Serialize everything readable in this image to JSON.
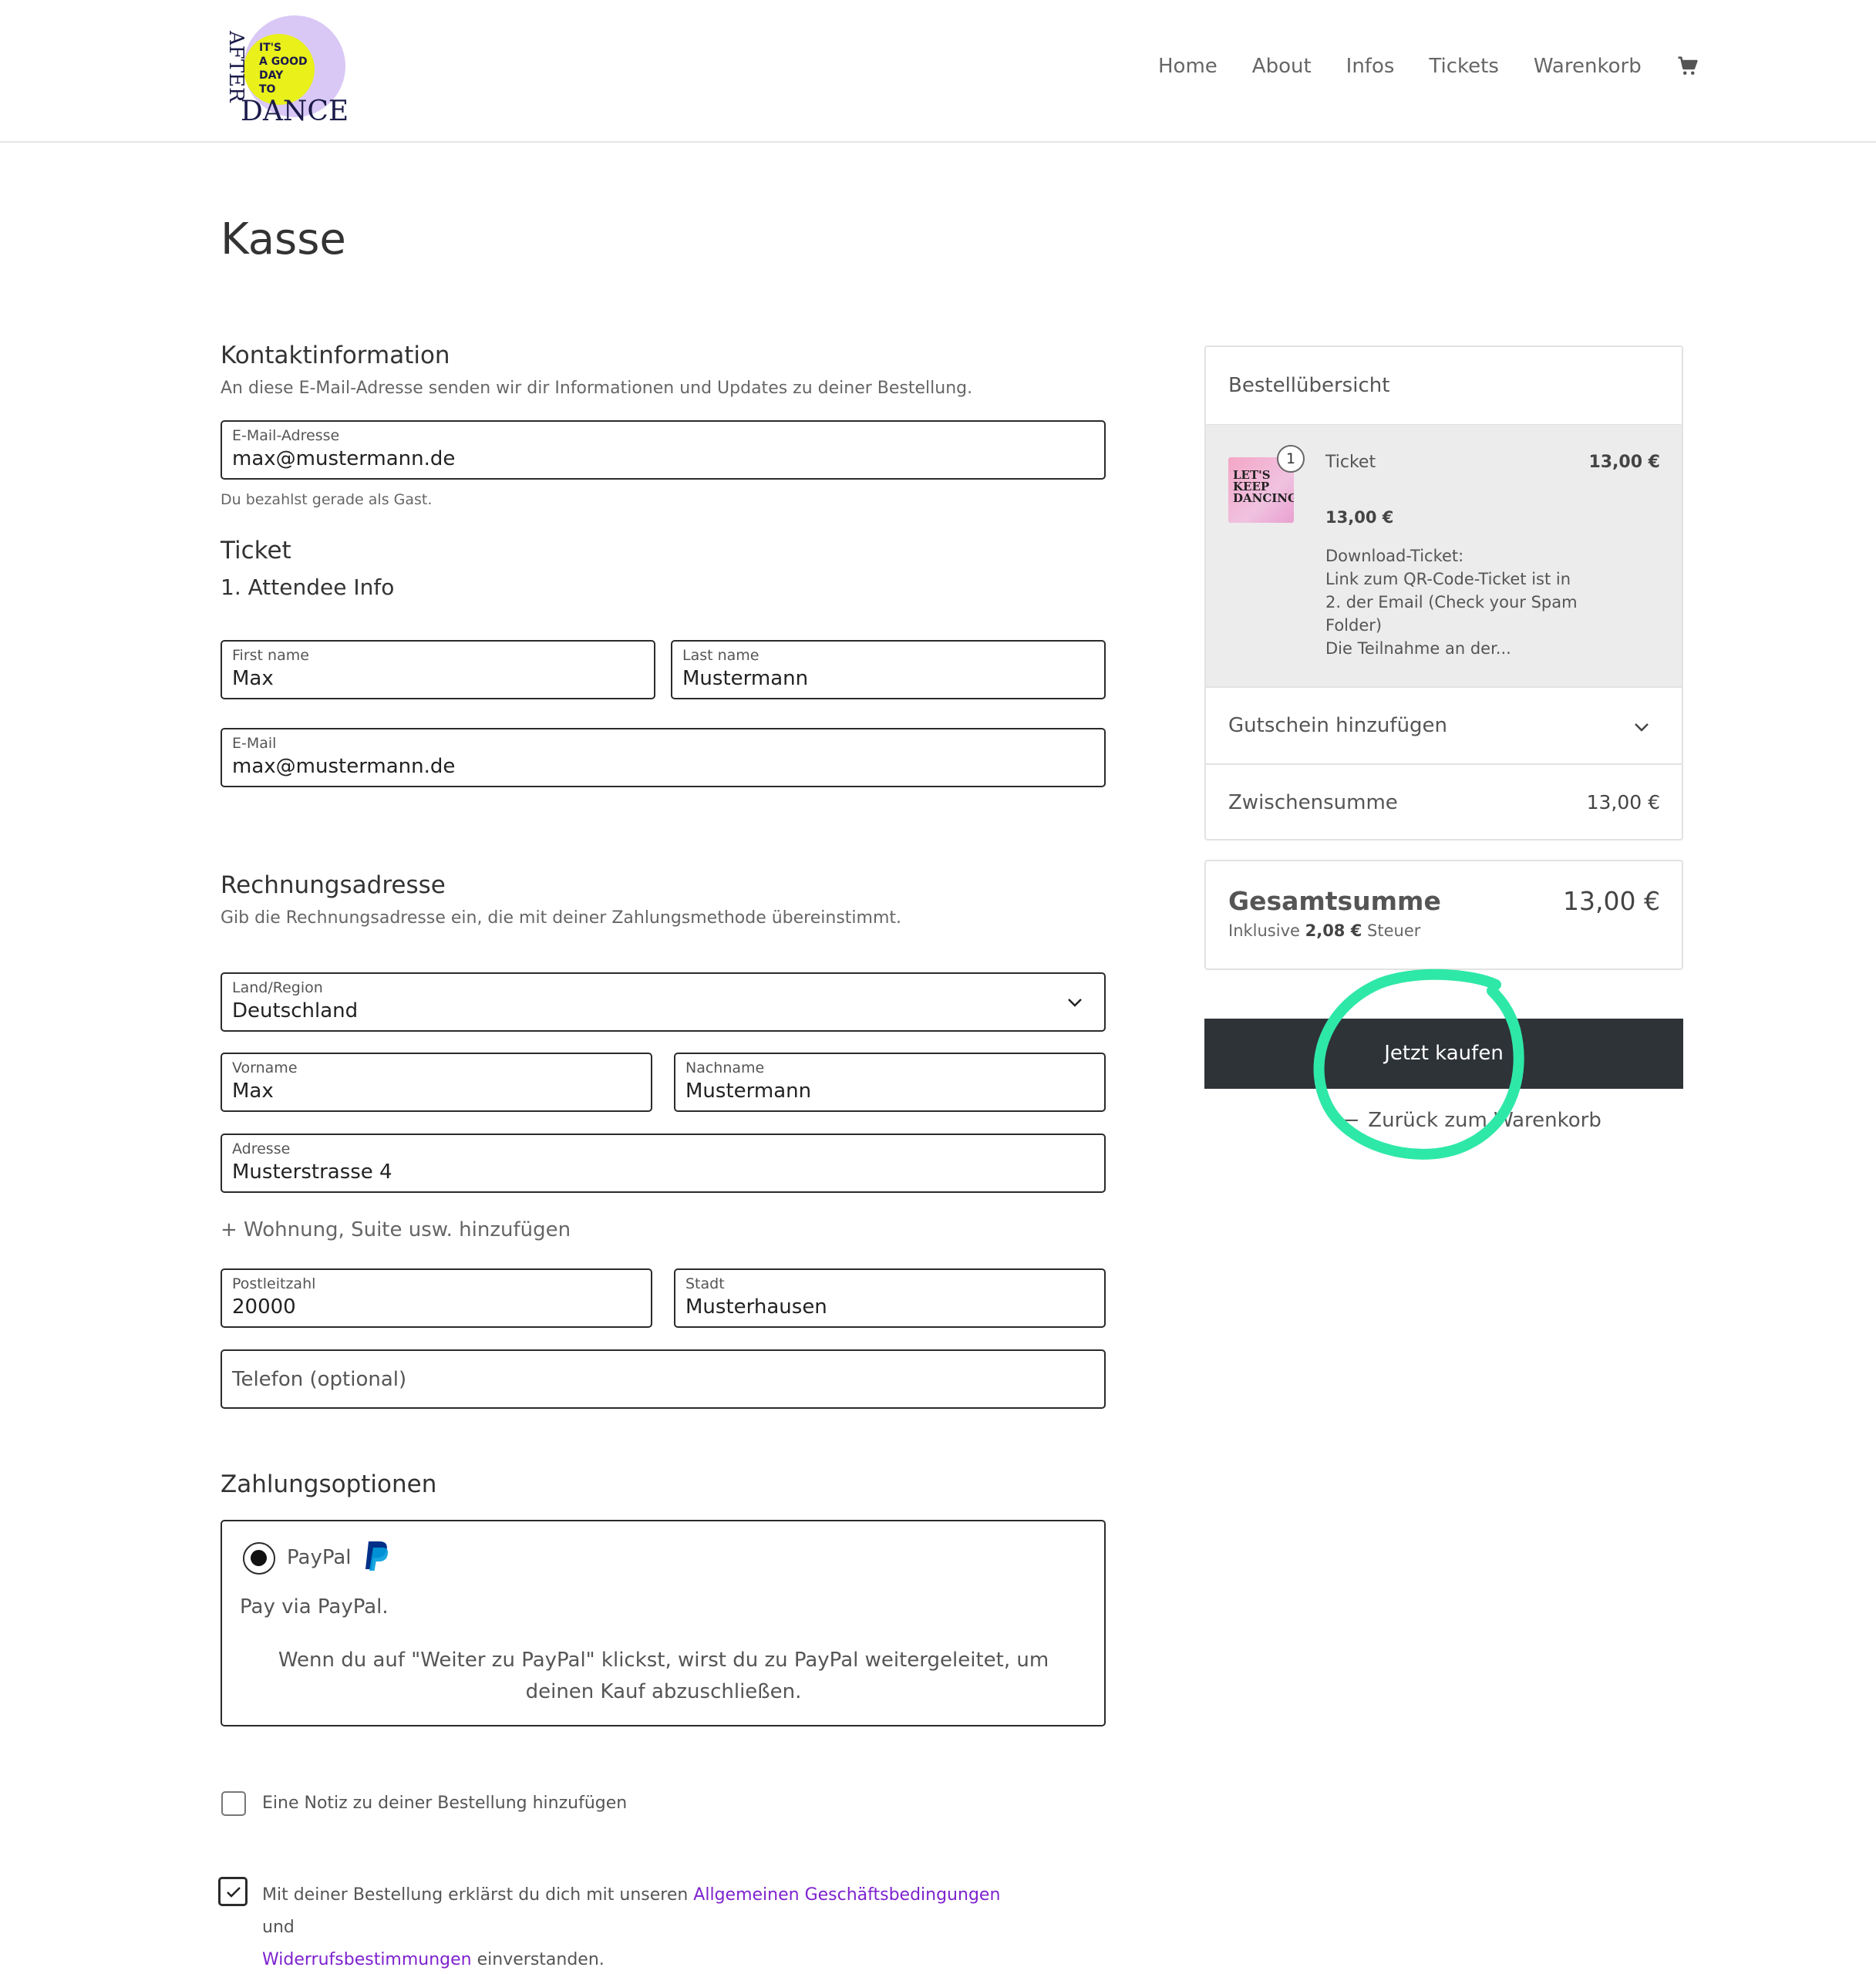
{
  "header": {
    "logo_text": [
      "IT'S",
      "A GOOD",
      "DAY",
      "TO",
      "DANCE",
      "AFTER"
    ],
    "nav": [
      "Home",
      "About",
      "Infos",
      "Tickets",
      "Warenkorb"
    ],
    "cart_icon": "cart-icon"
  },
  "page_title": "Kasse",
  "contact": {
    "title": "Kontaktinformation",
    "desc": "An diese E-Mail-Adresse senden wir dir Informationen und Updates zu deiner Bestellung.",
    "email_label": "E-Mail-Adresse",
    "email_value": "max@mustermann.de",
    "guest_note": "Du bezahlst gerade als Gast."
  },
  "ticket": {
    "title": "Ticket",
    "attendee_title": "1. Attendee Info",
    "first_name_label": "First name",
    "first_name_value": "Max",
    "last_name_label": "Last name",
    "last_name_value": "Mustermann",
    "email_label": "E-Mail",
    "email_value": "max@mustermann.de"
  },
  "billing": {
    "title": "Rechnungsadresse",
    "desc": "Gib die Rechnungsadresse ein, die mit deiner Zahlungsmethode übereinstimmt.",
    "country_label": "Land/Region",
    "country_value": "Deutschland",
    "firstname_label": "Vorname",
    "firstname_value": "Max",
    "lastname_label": "Nachname",
    "lastname_value": "Mustermann",
    "address_label": "Adresse",
    "address_value": "Musterstrasse 4",
    "add_apartment": "+ Wohnung, Suite usw. hinzufügen",
    "zip_label": "Postleitzahl",
    "zip_value": "20000",
    "city_label": "Stadt",
    "city_value": "Musterhausen",
    "phone_placeholder": "Telefon (optional)"
  },
  "payment": {
    "title": "Zahlungsoptionen",
    "method": "PayPal",
    "desc": "Pay via PayPal.",
    "note": "Wenn du auf \"Weiter zu PayPal\" klickst, wirst du zu PayPal weitergeleitet, um deinen Kauf abzuschließen.",
    "brand_color": "#003087"
  },
  "note_checkbox": "Eine Notiz zu deiner Bestellung hinzufügen",
  "terms": {
    "pre": "Mit deiner Bestellung erklärst du dich mit unseren ",
    "link1": "Allgemeinen Geschäftsbedingungen",
    "mid": " und",
    "link2": "Widerrufsbestimmungen",
    "post": " einverstanden.",
    "link_color": "#7e22ce"
  },
  "summary": {
    "title": "Bestellübersicht",
    "item": {
      "qty": "1",
      "name": "Ticket",
      "price": "13,00 €",
      "unit_price": "13,00 €",
      "thumb_text": "LET'S KEEP DANCING",
      "desc_lines": [
        "Download-Ticket:",
        "Link zum QR-Code-Ticket ist in",
        "2. der Email (Check your Spam",
        "Folder)",
        "Die Teilnahme an der..."
      ]
    },
    "coupon": "Gutschein hinzufügen",
    "subtotal_label": "Zwischensumme",
    "subtotal_value": "13,00 €"
  },
  "total": {
    "label": "Gesamtsumme",
    "value": "13,00 €",
    "tax_pre": "Inklusive ",
    "tax_amount": "2,08 €",
    "tax_post": " Steuer"
  },
  "actions": {
    "buy": "Jetzt kaufen",
    "back": "Zurück zum Warenkorb",
    "highlight_color": "#2ee8a8"
  }
}
